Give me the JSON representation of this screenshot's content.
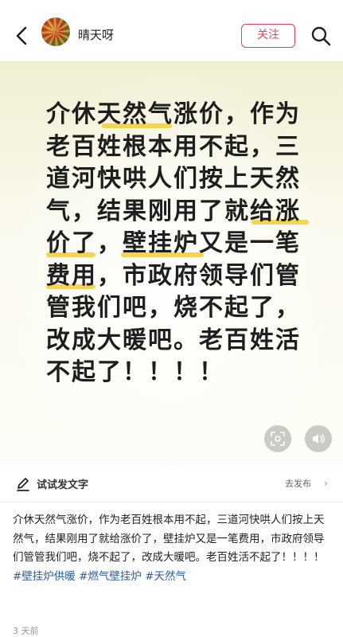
{
  "header": {
    "username": "晴天呀",
    "follow_label": "关注"
  },
  "image": {
    "lines": [
      "介休天然气涨价，作为",
      "老百姓根本用不起，三",
      "道河快哄人们按上天然",
      "气，结果刚用了就给涨",
      "价了，壁挂炉又是一笔",
      "费用，市政府领导们管",
      "管我们吧，烧不起了，",
      "改成大暖吧。老百姓活",
      "不起了！！！！"
    ],
    "highlight_color": "#f4d24a"
  },
  "compose": {
    "label": "试试发文字",
    "action": "去发布"
  },
  "caption": {
    "text": "介休天然气涨价，作为老百姓根本用不起，三道河快哄人们按上天然气，结果刚用了就给涨价了，壁挂炉又是一笔费用，市政府领导们管管我们吧，烧不起了，改成大暖吧。老百姓活不起了！！！！",
    "tags": [
      "#壁挂炉供暖",
      "#燃气壁挂炉",
      "#天然气"
    ],
    "tag_color": "#2e5d9e"
  },
  "meta": {
    "time": "3 天前"
  },
  "colors": {
    "accent": "#e8405a"
  }
}
